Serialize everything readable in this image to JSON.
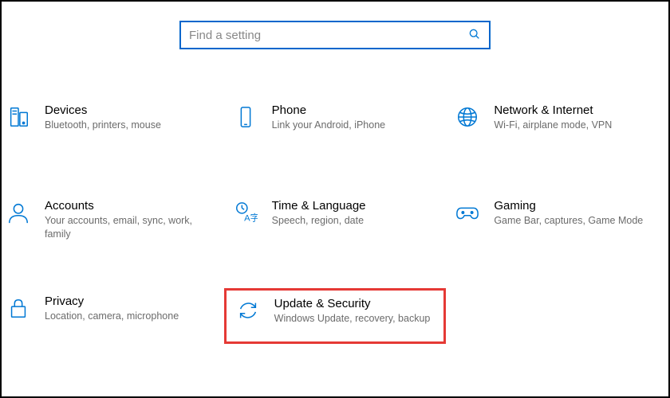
{
  "search": {
    "placeholder": "Find a setting"
  },
  "tiles": {
    "devices": {
      "title": "Devices",
      "sub": "Bluetooth, printers, mouse"
    },
    "phone": {
      "title": "Phone",
      "sub": "Link your Android, iPhone"
    },
    "network": {
      "title": "Network & Internet",
      "sub": "Wi-Fi, airplane mode, VPN"
    },
    "accounts": {
      "title": "Accounts",
      "sub": "Your accounts, email, sync, work, family"
    },
    "time": {
      "title": "Time & Language",
      "sub": "Speech, region, date"
    },
    "gaming": {
      "title": "Gaming",
      "sub": "Game Bar, captures, Game Mode"
    },
    "privacy": {
      "title": "Privacy",
      "sub": "Location, camera, microphone"
    },
    "update": {
      "title": "Update & Security",
      "sub": "Windows Update, recovery, backup"
    }
  }
}
